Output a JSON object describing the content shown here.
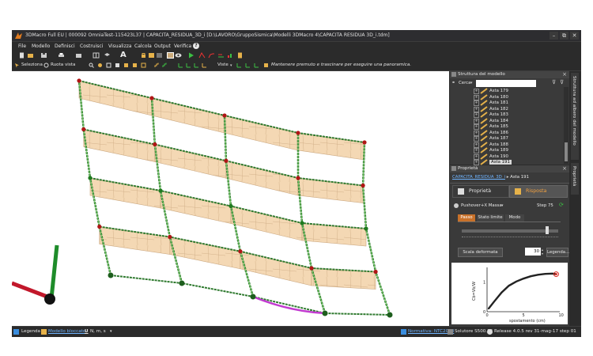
{
  "titlebar": {
    "title": "3DMacro Full EU | 000092 OmniaTest-115423L37 | CAPACITA_RESIDUA_3D_i [D:\\LAVORO\\GruppoSismica\\Modelli 3DMacro 4\\CAPACITA RESIDUA 3D_i.tdm]",
    "minimize": "–",
    "maximize": "⧉",
    "close": "✕"
  },
  "menu": {
    "items": [
      "File",
      "Modello",
      "Definisci",
      "Costruisci",
      "Visualizza",
      "Calcola",
      "Output",
      "Verifica"
    ],
    "help": "?"
  },
  "toolbar2": {
    "select_label": "Seleziona",
    "rotate_label": "Ruota vista",
    "view_label": "Viste",
    "hint": "Mantenere premuto e trascinare per eseguire una panoramica."
  },
  "tree": {
    "title": "Struttura del modello",
    "search_label": "Cerca",
    "search_value": "",
    "items": [
      "Asta 179",
      "Asta 180",
      "Asta 181",
      "Asta 182",
      "Asta 183",
      "Asta 184",
      "Asta 185",
      "Asta 186",
      "Asta 187",
      "Asta 188",
      "Asta 189",
      "Asta 190",
      "Asta 191"
    ],
    "selected": "Asta 191"
  },
  "props": {
    "title": "Proprietà",
    "path_link": "CAPACITA_RESIDUA_3D_i",
    "path_item": "Asta 191",
    "tab_props": "Proprietà",
    "tab_resp": "Risposta",
    "dropdown": "Pushover+X Massa",
    "step": "Step 75",
    "subtabs": [
      "Passo",
      "Stato limite",
      "Modo"
    ],
    "scale_button": "Scala deformata",
    "scale_value": "30",
    "legend_button": "Legenda..."
  },
  "chart_data": {
    "type": "line",
    "xlabel": "spostamento (cm)",
    "ylabel": "Cb=Vb/W",
    "xticks": [
      "0",
      "5",
      "10"
    ],
    "yticks": [
      "0",
      "1"
    ],
    "xlim": [
      0,
      10
    ],
    "ylim": [
      0,
      1.5
    ],
    "series": [
      {
        "values": [
          [
            0.2,
            0.1
          ],
          [
            1,
            0.35
          ],
          [
            2,
            0.65
          ],
          [
            3,
            0.88
          ],
          [
            4,
            1.02
          ],
          [
            5,
            1.12
          ],
          [
            6,
            1.2
          ],
          [
            7,
            1.25
          ],
          [
            8,
            1.28
          ],
          [
            9,
            1.29
          ],
          [
            9.5,
            1.27
          ]
        ]
      }
    ],
    "marker_point": [
      9.5,
      1.27
    ],
    "colors": {
      "line": "#222222",
      "marker": "#d9261c"
    }
  },
  "sidetabs": {
    "tree": "Struttura ad albero del modello",
    "props": "Proprietà"
  },
  "status": {
    "legend": "Legenda",
    "locked": "Modello bloccato",
    "units": "N, m, s",
    "normative": "Normativa: NTC2008",
    "solver": "Solutore S500.02",
    "release": "Release 4.0.5 rev 31-mag-17 step 01"
  }
}
